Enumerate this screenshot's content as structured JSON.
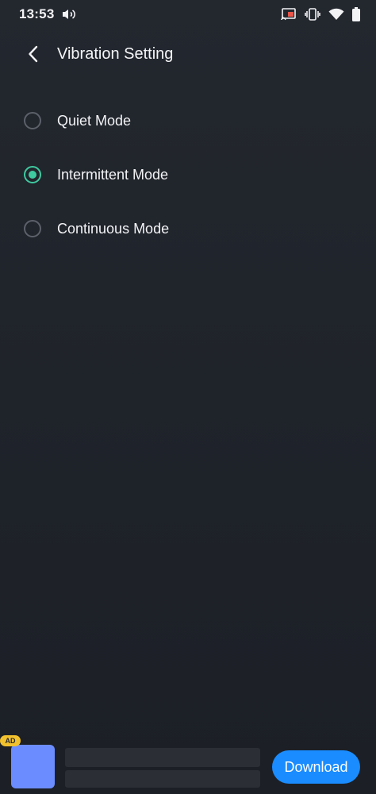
{
  "status_bar": {
    "time": "13:53",
    "left_icons": [
      "volume-icon"
    ],
    "right_icons": [
      "cast-icon",
      "vibrate-icon",
      "wifi-icon",
      "battery-icon"
    ]
  },
  "header": {
    "back_icon": "chevron-left-icon",
    "title": "Vibration Setting"
  },
  "options": [
    {
      "label": "Quiet Mode",
      "selected": false
    },
    {
      "label": "Intermittent Mode",
      "selected": true
    },
    {
      "label": "Continuous Mode",
      "selected": false
    }
  ],
  "ad": {
    "badge": "AD",
    "button_label": "Download"
  },
  "colors": {
    "accent": "#3fc9a0",
    "button": "#1a8cff",
    "background": "#1f232b"
  }
}
